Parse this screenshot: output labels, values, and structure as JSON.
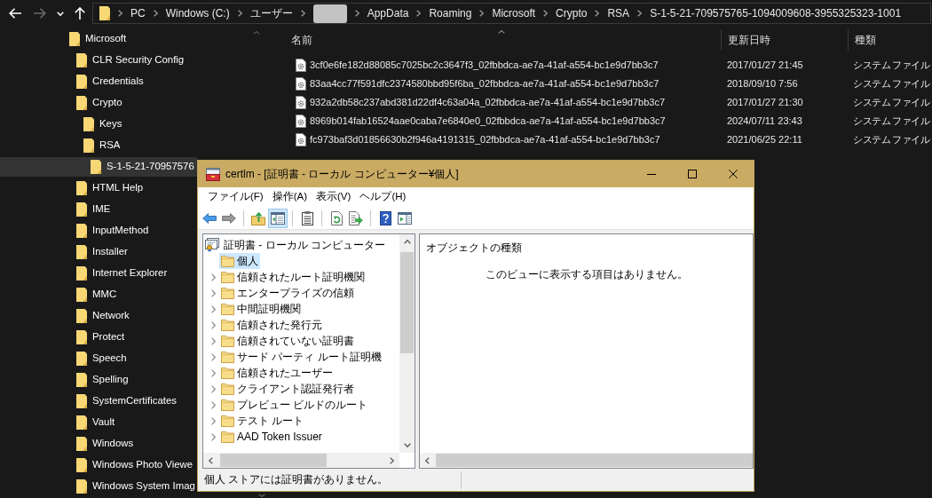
{
  "explorer": {
    "nav": [
      {
        "kind": "back",
        "disabled": false
      },
      {
        "kind": "forward",
        "disabled": true
      },
      {
        "kind": "recent",
        "disabled": false
      },
      {
        "kind": "up",
        "disabled": false
      }
    ],
    "breadcrumbs": [
      {
        "kind": "text",
        "label": "PC"
      },
      {
        "kind": "text",
        "label": "Windows (C:)"
      },
      {
        "kind": "text",
        "label": "ユーザー"
      },
      {
        "kind": "redacted"
      },
      {
        "kind": "text",
        "label": "AppData"
      },
      {
        "kind": "text",
        "label": "Roaming"
      },
      {
        "kind": "text",
        "label": "Microsoft"
      },
      {
        "kind": "text",
        "label": "Crypto"
      },
      {
        "kind": "text",
        "label": "RSA"
      },
      {
        "kind": "text",
        "label": "S-1-5-21-709575765-1094009608-3955325323-1001"
      }
    ],
    "tree": [
      {
        "label": "Microsoft",
        "selected": false,
        "children": [
          {
            "label": "CLR Security Config",
            "selected": false
          },
          {
            "label": "Credentials",
            "selected": false
          },
          {
            "label": "Crypto",
            "selected": false,
            "children": [
              {
                "label": "Keys",
                "selected": false
              },
              {
                "label": "RSA",
                "selected": false,
                "children": [
                  {
                    "label": "S-1-5-21-70957576",
                    "selected": true
                  }
                ]
              }
            ]
          },
          {
            "label": "HTML Help",
            "selected": false
          },
          {
            "label": "IME",
            "selected": false
          },
          {
            "label": "InputMethod",
            "selected": false
          },
          {
            "label": "Installer",
            "selected": false
          },
          {
            "label": "Internet Explorer",
            "selected": false
          },
          {
            "label": "MMC",
            "selected": false
          },
          {
            "label": "Network",
            "selected": false
          },
          {
            "label": "Protect",
            "selected": false
          },
          {
            "label": "Speech",
            "selected": false
          },
          {
            "label": "Spelling",
            "selected": false
          },
          {
            "label": "SystemCertificates",
            "selected": false
          },
          {
            "label": "Vault",
            "selected": false
          },
          {
            "label": "Windows",
            "selected": false
          },
          {
            "label": "Windows Photo Viewe",
            "selected": false
          },
          {
            "label": "Windows System Imag",
            "selected": false
          }
        ]
      }
    ],
    "columns": [
      "名前",
      "更新日時",
      "種類"
    ],
    "files": [
      {
        "name": "3cf0e6fe182d88085c7025bc2c3647f3_02fbbdca-ae7a-41af-a554-bc1e9d7bb3c7",
        "modified": "2017/01/27 21:45",
        "type": "システム ファイル"
      },
      {
        "name": "83aa4cc77f591dfc2374580bbd95f6ba_02fbbdca-ae7a-41af-a554-bc1e9d7bb3c7",
        "modified": "2018/09/10 7:56",
        "type": "システム ファイル"
      },
      {
        "name": "932a2db58c237abd381d22df4c63a04a_02fbbdca-ae7a-41af-a554-bc1e9d7bb3c7",
        "modified": "2017/01/27 21:30",
        "type": "システム ファイル"
      },
      {
        "name": "8969b014fab16524aae0caba7e6840e0_02fbbdca-ae7a-41af-a554-bc1e9d7bb3c7",
        "modified": "2024/07/11 23:43",
        "type": "システム ファイル"
      },
      {
        "name": "fc973baf3d01856630b2f946a4191315_02fbbdca-ae7a-41af-a554-bc1e9d7bb3c7",
        "modified": "2021/06/25 22:11",
        "type": "システム ファイル"
      }
    ]
  },
  "certlm": {
    "title": "certlm - [証明書 - ローカル コンピューター¥個人]",
    "menu": [
      "ファイル(F)",
      "操作(A)",
      "表示(V)",
      "ヘルプ(H)"
    ],
    "toolbar": [
      {
        "kind": "back",
        "pressed": false
      },
      {
        "kind": "forward",
        "pressed": false
      },
      {
        "kind": "separator"
      },
      {
        "kind": "up",
        "pressed": false
      },
      {
        "kind": "tree",
        "pressed": true
      },
      {
        "kind": "separator"
      },
      {
        "kind": "properties",
        "pressed": false
      },
      {
        "kind": "separator"
      },
      {
        "kind": "refresh",
        "pressed": false
      },
      {
        "kind": "export",
        "pressed": false
      },
      {
        "kind": "separator"
      },
      {
        "kind": "help",
        "pressed": false
      },
      {
        "kind": "actions",
        "pressed": false
      }
    ],
    "tree": {
      "label": "証明書 - ローカル コンピューター",
      "selected": false,
      "children": [
        {
          "label": "個人",
          "selected": true,
          "expandable": false
        },
        {
          "label": "信頼されたルート証明機関",
          "selected": false,
          "expandable": true
        },
        {
          "label": "エンタープライズの信頼",
          "selected": false,
          "expandable": true
        },
        {
          "label": "中間証明機関",
          "selected": false,
          "expandable": true
        },
        {
          "label": "信頼された発行元",
          "selected": false,
          "expandable": true
        },
        {
          "label": "信頼されていない証明書",
          "selected": false,
          "expandable": true
        },
        {
          "label": "サード パーティ ルート証明機",
          "selected": false,
          "expandable": true
        },
        {
          "label": "信頼されたユーザー",
          "selected": false,
          "expandable": true
        },
        {
          "label": "クライアント認証発行者",
          "selected": false,
          "expandable": true
        },
        {
          "label": "プレビュー ビルドのルート",
          "selected": false,
          "expandable": true
        },
        {
          "label": "テスト ルート",
          "selected": false,
          "expandable": true
        },
        {
          "label": "AAD Token Issuer",
          "selected": false,
          "expandable": true
        }
      ]
    },
    "list_header": "オブジェクトの種類",
    "empty_message": "このビューに表示する項目はありません。",
    "status": "個人 ストアには証明書がありません。"
  }
}
